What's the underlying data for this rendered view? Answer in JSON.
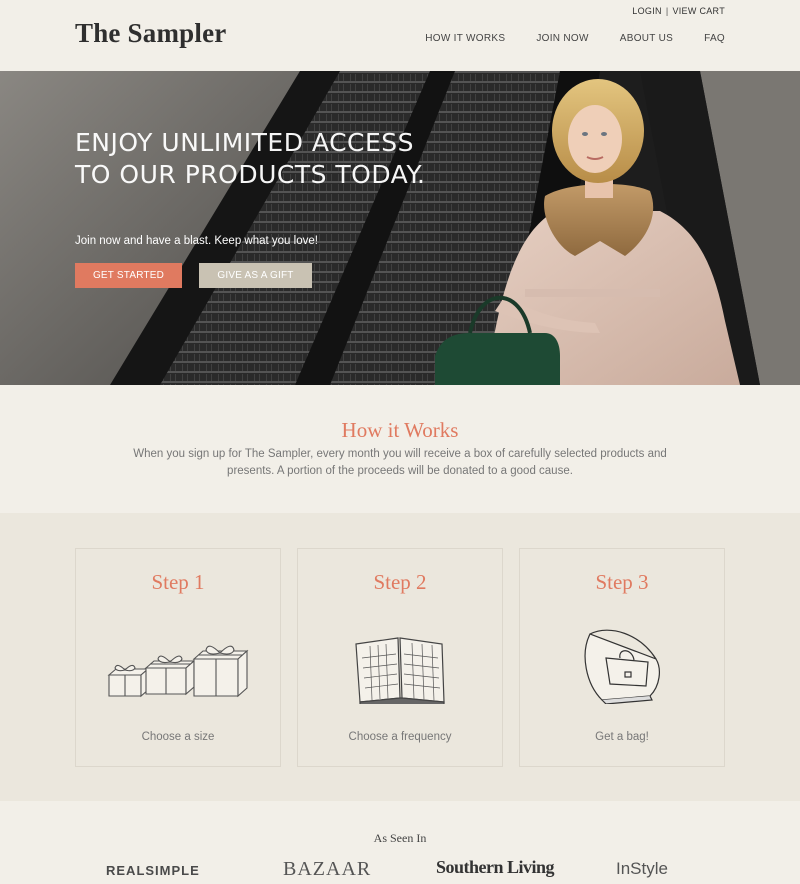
{
  "brand": {
    "name": "The Sampler"
  },
  "utility": {
    "login": "LOGIN",
    "separator": "|",
    "view_cart": "VIEW CART"
  },
  "nav": {
    "items": [
      {
        "label": "HOW IT WORKS"
      },
      {
        "label": "JOIN NOW"
      },
      {
        "label": "ABOUT US"
      },
      {
        "label": "FAQ"
      }
    ]
  },
  "hero": {
    "headline_line1": "Enjoy unlimited access",
    "headline_line2": "to our products today.",
    "subline": "Join now and have a blast. Keep what you love!",
    "primary_button": "GET STARTED",
    "secondary_button": "GIVE AS A GIFT"
  },
  "how": {
    "title": "How it Works",
    "body": "When you sign up for The Sampler, every month you will receive a box of carefully selected products and presents. A portion of the proceeds will be donated to a good cause."
  },
  "steps": [
    {
      "title": "Step 1",
      "caption": "Choose a size",
      "icon": "gift-boxes-icon"
    },
    {
      "title": "Step 2",
      "caption": "Choose a frequency",
      "icon": "calendar-book-icon"
    },
    {
      "title": "Step 3",
      "caption": "Get a bag!",
      "icon": "handbag-icon"
    }
  ],
  "seen": {
    "title": "As Seen In",
    "logos": [
      "REALSIMPLE",
      "BAZAAR",
      "Southern Living",
      "InStyle"
    ]
  },
  "colors": {
    "accent": "#e07a60",
    "gift_button": "#c9c2b3",
    "background": "#f2efe8"
  }
}
